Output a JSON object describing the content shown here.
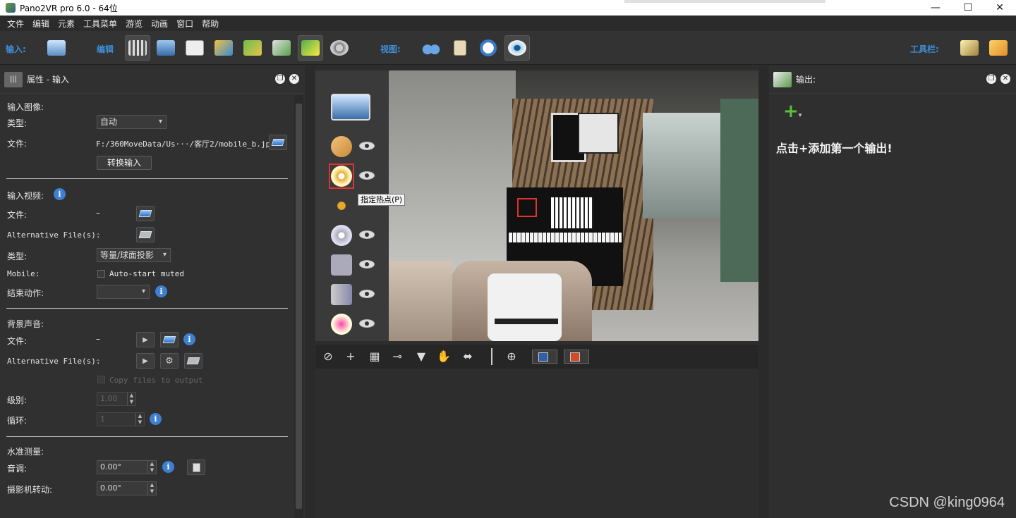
{
  "window": {
    "title": "Pano2VR pro 6.0 - 64位"
  },
  "menu": [
    "文件",
    "编辑",
    "元素",
    "工具菜单",
    "游览",
    "动画",
    "窗口",
    "帮助"
  ],
  "toolbar": {
    "input_label": "输入:",
    "edit_label": "编辑",
    "view_label": "视图:",
    "toolbar_label": "工具栏:"
  },
  "properties_panel": {
    "title": "属性 - 输入",
    "input_image": {
      "section": "输入图像:",
      "type_label": "类型:",
      "type_value": "自动",
      "file_label": "文件:",
      "file_value": "F:/360MoveData/Us···/客厅2/mobile_b.jpg",
      "convert_button": "转换输入"
    },
    "input_video": {
      "section": "输入视频:",
      "file_label": "文件:",
      "file_value": "–",
      "alt_label": "Alternative File(s):",
      "alt_value": "–",
      "type_label": "类型:",
      "type_value": "等量/球面投影",
      "mobile_label": "Mobile:",
      "mobile_checkbox": "Auto-start muted",
      "end_action_label": "结束动作:",
      "end_action_value": ""
    },
    "background_sound": {
      "section": "背景声音:",
      "file_label": "文件:",
      "file_value": "–",
      "alt_label": "Alternative File(s):",
      "alt_value": "–",
      "copy_checkbox": "Copy files to output",
      "level_label": "级别:",
      "level_value": "1.00",
      "loop_label": "循环:",
      "loop_value": "1"
    },
    "leveling": {
      "section": "水准测量:",
      "pitch_label": "音调:",
      "pitch_value": "0.00°",
      "roll_label": "摄影机转动:",
      "roll_value": "0.00°"
    }
  },
  "viewer": {
    "tooltip": "指定热点(P)"
  },
  "output_panel": {
    "title": "输出:",
    "hint": "点击+添加第一个输出!"
  },
  "watermark": "CSDN @king0964",
  "colors": {
    "accent": "#3e8fd8",
    "highlight": "#e0322e",
    "info": "#3f7fd0"
  }
}
